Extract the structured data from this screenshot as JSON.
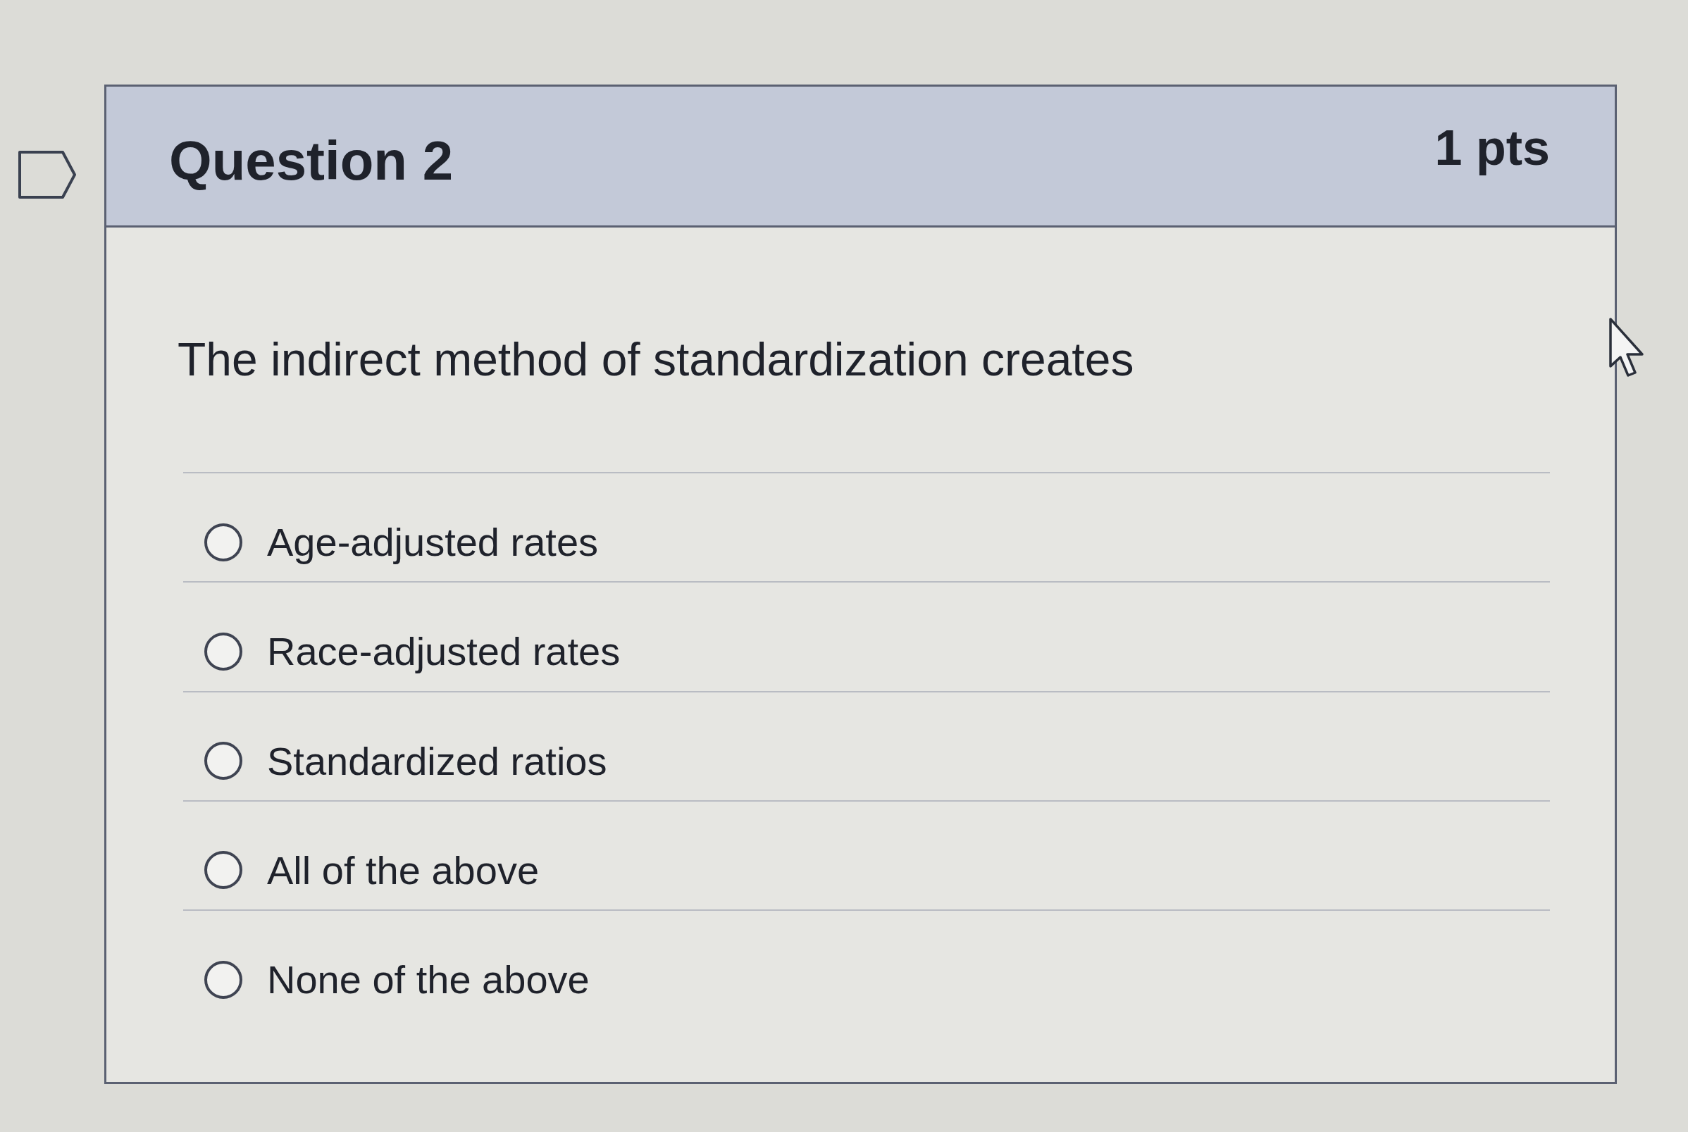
{
  "question": {
    "flagged": false,
    "title": "Question 2",
    "points": "1 pts",
    "text": "The indirect method of standardization creates",
    "answers": [
      {
        "label": "Age-adjusted rates",
        "selected": false
      },
      {
        "label": "Race-adjusted rates",
        "selected": false
      },
      {
        "label": "Standardized ratios",
        "selected": false
      },
      {
        "label": "All of the above",
        "selected": false
      },
      {
        "label": "None of the above",
        "selected": false
      }
    ]
  }
}
